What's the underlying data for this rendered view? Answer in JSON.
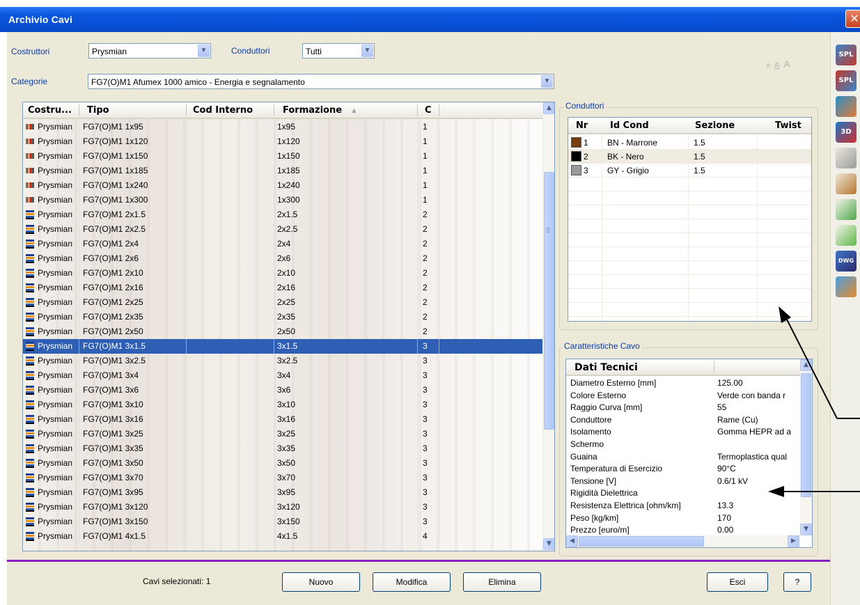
{
  "window": {
    "title": "Archivio Cavi",
    "close_label": "✕"
  },
  "filters": {
    "costruttori_label": "Costruttori",
    "costruttori_value": "Prysmian",
    "conduttori_label": "Conduttori",
    "conduttori_value": "Tutti",
    "categorie_label": "Categorie",
    "categorie_value": "FG7(O)M1 Afumex 1000 amico - Energia e segnalamento"
  },
  "font_size_controls": [
    "A",
    "A",
    "A"
  ],
  "cable_list": {
    "columns": [
      "Costru...",
      "Tipo",
      "Cod Interno",
      "Formazione",
      "C"
    ],
    "sort_indicator": "▲",
    "rows": [
      {
        "icon": "cable-single-icon",
        "costruttore": "Prysmian",
        "tipo": "FG7(O)M1 1x95",
        "cod": "",
        "formazione": "1x95",
        "c": "1"
      },
      {
        "icon": "cable-single-icon",
        "costruttore": "Prysmian",
        "tipo": "FG7(O)M1 1x120",
        "cod": "",
        "formazione": "1x120",
        "c": "1"
      },
      {
        "icon": "cable-single-icon",
        "costruttore": "Prysmian",
        "tipo": "FG7(O)M1 1x150",
        "cod": "",
        "formazione": "1x150",
        "c": "1"
      },
      {
        "icon": "cable-single-icon",
        "costruttore": "Prysmian",
        "tipo": "FG7(O)M1 1x185",
        "cod": "",
        "formazione": "1x185",
        "c": "1"
      },
      {
        "icon": "cable-single-icon",
        "costruttore": "Prysmian",
        "tipo": "FG7(O)M1 1x240",
        "cod": "",
        "formazione": "1x240",
        "c": "1"
      },
      {
        "icon": "cable-single-icon",
        "costruttore": "Prysmian",
        "tipo": "FG7(O)M1 1x300",
        "cod": "",
        "formazione": "1x300",
        "c": "1"
      },
      {
        "icon": "cable-multi-icon",
        "costruttore": "Prysmian",
        "tipo": "FG7(O)M1 2x1.5",
        "cod": "",
        "formazione": "2x1.5",
        "c": "2"
      },
      {
        "icon": "cable-multi-icon",
        "costruttore": "Prysmian",
        "tipo": "FG7(O)M1 2x2.5",
        "cod": "",
        "formazione": "2x2.5",
        "c": "2"
      },
      {
        "icon": "cable-multi-icon",
        "costruttore": "Prysmian",
        "tipo": "FG7(O)M1 2x4",
        "cod": "",
        "formazione": "2x4",
        "c": "2"
      },
      {
        "icon": "cable-multi-icon",
        "costruttore": "Prysmian",
        "tipo": "FG7(O)M1 2x6",
        "cod": "",
        "formazione": "2x6",
        "c": "2"
      },
      {
        "icon": "cable-multi-icon",
        "costruttore": "Prysmian",
        "tipo": "FG7(O)M1 2x10",
        "cod": "",
        "formazione": "2x10",
        "c": "2"
      },
      {
        "icon": "cable-multi-icon",
        "costruttore": "Prysmian",
        "tipo": "FG7(O)M1 2x16",
        "cod": "",
        "formazione": "2x16",
        "c": "2"
      },
      {
        "icon": "cable-multi-icon",
        "costruttore": "Prysmian",
        "tipo": "FG7(O)M1 2x25",
        "cod": "",
        "formazione": "2x25",
        "c": "2"
      },
      {
        "icon": "cable-multi-icon",
        "costruttore": "Prysmian",
        "tipo": "FG7(O)M1 2x35",
        "cod": "",
        "formazione": "2x35",
        "c": "2"
      },
      {
        "icon": "cable-multi-icon",
        "costruttore": "Prysmian",
        "tipo": "FG7(O)M1 2x50",
        "cod": "",
        "formazione": "2x50",
        "c": "2"
      },
      {
        "icon": "cable-multi-icon",
        "costruttore": "Prysmian",
        "tipo": "FG7(O)M1 3x1.5",
        "cod": "",
        "formazione": "3x1.5",
        "c": "3",
        "selected": true
      },
      {
        "icon": "cable-multi-icon",
        "costruttore": "Prysmian",
        "tipo": "FG7(O)M1 3x2.5",
        "cod": "",
        "formazione": "3x2.5",
        "c": "3"
      },
      {
        "icon": "cable-multi-icon",
        "costruttore": "Prysmian",
        "tipo": "FG7(O)M1 3x4",
        "cod": "",
        "formazione": "3x4",
        "c": "3"
      },
      {
        "icon": "cable-multi-icon",
        "costruttore": "Prysmian",
        "tipo": "FG7(O)M1 3x6",
        "cod": "",
        "formazione": "3x6",
        "c": "3"
      },
      {
        "icon": "cable-multi-icon",
        "costruttore": "Prysmian",
        "tipo": "FG7(O)M1 3x10",
        "cod": "",
        "formazione": "3x10",
        "c": "3"
      },
      {
        "icon": "cable-multi-icon",
        "costruttore": "Prysmian",
        "tipo": "FG7(O)M1 3x16",
        "cod": "",
        "formazione": "3x16",
        "c": "3"
      },
      {
        "icon": "cable-multi-icon",
        "costruttore": "Prysmian",
        "tipo": "FG7(O)M1 3x25",
        "cod": "",
        "formazione": "3x25",
        "c": "3"
      },
      {
        "icon": "cable-multi-icon",
        "costruttore": "Prysmian",
        "tipo": "FG7(O)M1 3x35",
        "cod": "",
        "formazione": "3x35",
        "c": "3"
      },
      {
        "icon": "cable-multi-icon",
        "costruttore": "Prysmian",
        "tipo": "FG7(O)M1 3x50",
        "cod": "",
        "formazione": "3x50",
        "c": "3"
      },
      {
        "icon": "cable-multi-icon",
        "costruttore": "Prysmian",
        "tipo": "FG7(O)M1 3x70",
        "cod": "",
        "formazione": "3x70",
        "c": "3"
      },
      {
        "icon": "cable-multi-icon",
        "costruttore": "Prysmian",
        "tipo": "FG7(O)M1 3x95",
        "cod": "",
        "formazione": "3x95",
        "c": "3"
      },
      {
        "icon": "cable-multi-icon",
        "costruttore": "Prysmian",
        "tipo": "FG7(O)M1 3x120",
        "cod": "",
        "formazione": "3x120",
        "c": "3"
      },
      {
        "icon": "cable-multi-icon",
        "costruttore": "Prysmian",
        "tipo": "FG7(O)M1 3x150",
        "cod": "",
        "formazione": "3x150",
        "c": "3"
      },
      {
        "icon": "cable-multi-icon",
        "costruttore": "Prysmian",
        "tipo": "FG7(O)M1 4x1.5",
        "cod": "",
        "formazione": "4x1.5",
        "c": "4"
      }
    ]
  },
  "conduttori": {
    "group_title": "Conduttori",
    "columns": [
      "Nr",
      "Id Cond",
      "Sezione",
      "Twist"
    ],
    "rows": [
      {
        "nr": "1",
        "id": "BN - Marrone",
        "sezione": "1.5",
        "twist": "",
        "color": "#7a3d0c"
      },
      {
        "nr": "2",
        "id": "BK - Nero",
        "sezione": "1.5",
        "twist": "",
        "color": "#000000"
      },
      {
        "nr": "3",
        "id": "GY - Grigio",
        "sezione": "1.5",
        "twist": "",
        "color": "#9a9a9a"
      }
    ]
  },
  "caratteristiche": {
    "group_title": "Caratteristiche Cavo",
    "header": "Dati Tecnici",
    "rows": [
      {
        "label": "Diametro Esterno [mm]",
        "value": "125.00"
      },
      {
        "label": "Colore Esterno",
        "value": "Verde con banda r"
      },
      {
        "label": "Raggio Curva [mm]",
        "value": "55"
      },
      {
        "label": "Conduttore",
        "value": "Rame (Cu)"
      },
      {
        "label": "Isolamento",
        "value": "Gomma HEPR ad a"
      },
      {
        "label": "Schermo",
        "value": ""
      },
      {
        "label": "Guaina",
        "value": "Termoplastica qual"
      },
      {
        "label": "Temperatura di Esercizio",
        "value": "90°C"
      },
      {
        "label": "Tensione [V]",
        "value": "0.6/1 kV"
      },
      {
        "label": "Rigidità Dielettrica",
        "value": ""
      },
      {
        "label": "Resistenza Elettrica [ohm/km]",
        "value": "13.3"
      },
      {
        "label": "Peso [kg/km]",
        "value": "170"
      },
      {
        "label": "Prezzo [euro/m]",
        "value": "0.00"
      }
    ]
  },
  "footer": {
    "status": "Cavi selezionati: 1",
    "nuovo": "Nuovo",
    "modifica": "Modifica",
    "elimina": "Elimina",
    "esci": "Esci",
    "help": "?"
  },
  "toolbar": {
    "buttons": [
      {
        "icon": "spl-icon",
        "label": "SPL"
      },
      {
        "icon": "spl-red-icon",
        "label": "SPL"
      },
      {
        "icon": "cable-tool-icon",
        "label": ""
      },
      {
        "icon": "3d-icon",
        "label": "3D"
      },
      {
        "icon": "conduit-icon",
        "label": ""
      },
      {
        "icon": "section-icon",
        "label": ""
      },
      {
        "icon": "check-icon",
        "label": ""
      },
      {
        "icon": "check-pen-icon",
        "label": ""
      },
      {
        "icon": "dwg-export-icon",
        "label": "DWG"
      },
      {
        "icon": "settings-gear-icon",
        "label": ""
      }
    ]
  },
  "colors": {
    "titlebar": "#0a58e0",
    "selection": "#2f5fb4",
    "group_title": "#0a3ca8",
    "separator": "#8a1fc0"
  }
}
